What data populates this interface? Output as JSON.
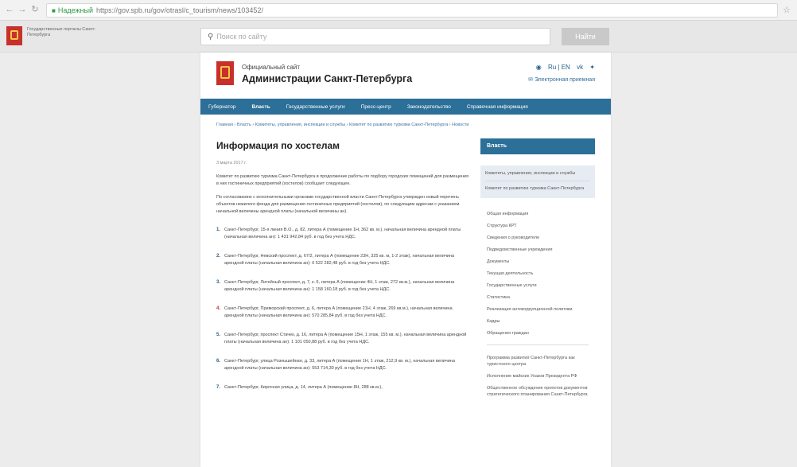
{
  "browser": {
    "secure_label": "Надежный",
    "url": "https://gov.spb.ru/gov/otrasl/c_tourism/news/103452/"
  },
  "portal": {
    "name": "Государственные порталы Санкт-Петербурга",
    "search_placeholder": "Поиск по сайту",
    "search_button": "Найти"
  },
  "header": {
    "subtitle": "Официальный сайт",
    "title": "Администрации Санкт-Петербурга",
    "lang": "Ru | EN",
    "mail": "Электронная приемная"
  },
  "menu": [
    {
      "label": "Губернатор",
      "active": false
    },
    {
      "label": "Власть",
      "active": true
    },
    {
      "label": "Государственные услуги",
      "active": false
    },
    {
      "label": "Пресс-центр",
      "active": false
    },
    {
      "label": "Законодательство",
      "active": false
    },
    {
      "label": "Справочная информация",
      "active": false
    }
  ],
  "breadcrumb": "Главная › Власть › Комитеты, управления, инспекции и службы › Комитет по развитию туризма Санкт-Петербурга › Новости",
  "article": {
    "title": "Информация по хостелам",
    "date": "3 марта 2017 г.",
    "para1": "Комитет по развитию туризма Санкт-Петербурга в продолжение работы по подбору городских помещений для размещения в них гостиничных предприятий (хостелов) сообщает следующее.",
    "para2": "По согласованию с исполнительными органами государственной власти Санкт-Петербурга утвержден новый перечень объектов нежилого фонда для размещения гостиничных предприятий (хостелов), по следующим адресам с указанием начальной величины арендной платы (начальной величины ан).",
    "items": [
      {
        "num": "1.",
        "text": "Санкт-Петербург, 15-я линия В.О., д. 82, литера А (помещение 1Н, 362 кв. м.), начальная величина арендной платы (начальная величина ан): 1 431 942,84 руб. в год без учета НДС."
      },
      {
        "num": "2.",
        "text": "Санкт-Петербург, Невский проспект, д. 67/2, литера А (помещение 23Н, 325 кв. м, 1-2 этаж), начальная величина арендной платы (начальная величина ан): 6 522 282,48 руб. в год без учета НДС."
      },
      {
        "num": "3.",
        "text": "Санкт-Петербург, Литейный проспект, д. 7, к. 6, литера А (помещение 4Н, 1 этаж, 272 кв.м.), начальная величина арендной платы (начальная величина ан): 1 158 160,18 руб. в год без учета НДС."
      },
      {
        "num": "4.",
        "text": "Санкт-Петербург, Приморский проспект, д. 6, литера А (помещение 21Н, 4 этаж, 269 кв.м.), начальная величина арендной платы (начальная величина ан): 570 285,84 руб. в год без учета НДС."
      },
      {
        "num": "5.",
        "text": "Санкт-Петербург, проспект Стачек, д. 16, литера А (помещение 15Н, 1 этаж, 155 кв. м.), начальная величина арендной платы (начальная величина ан): 1 101 050,88 руб. в год без учета НДС."
      },
      {
        "num": "6.",
        "text": "Санкт-Петербург, улица Рознышейная, д. 33, литера А (помещение 1Н, 1 этаж, 212,9 кв. м.), начальная величина арендной платы (начальная величина ан): 553 714,30 руб. в год без учета НДС."
      },
      {
        "num": "7.",
        "text": "Санкт-Петербург, Кирочная улица, д. 14, литера А (помещение 8Н, 288 кв.м.),"
      }
    ]
  },
  "sidebar": {
    "head": "Власть",
    "box_items": [
      "Комитеты, управления, инспекции и службы",
      "Комитет по развитию туризма Санкт-Петербурга"
    ],
    "links": [
      "Общая информация",
      "Структура КРТ",
      "Сведения о руководителе",
      "Подведомственные учреждения",
      "Документы",
      "Текущая деятельность",
      "Государственные услуги",
      "Статистика",
      "Реализация антикоррупционной политики",
      "Кадры",
      "Обращения граждан"
    ],
    "links2": [
      "Программа развития Санкт-Петербурга как туристского центра",
      "Исполнение майских Указов Президента РФ",
      "Общественное обсуждение проектов документов стратегического планирования Санкт-Петербурга"
    ]
  }
}
